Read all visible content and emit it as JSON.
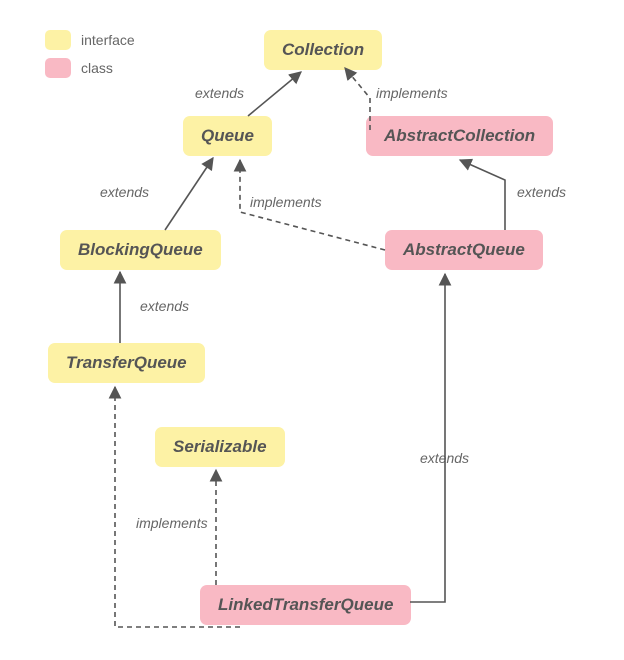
{
  "legend": {
    "interface": "interface",
    "class": "class"
  },
  "colors": {
    "interface": "#fdf2a5",
    "class": "#f9b9c4",
    "text": "#555555",
    "edge": "#555555"
  },
  "nodes": {
    "collection": {
      "label": "Collection",
      "kind": "interface"
    },
    "queue": {
      "label": "Queue",
      "kind": "interface"
    },
    "abstractCollection": {
      "label": "AbstractCollection",
      "kind": "class"
    },
    "blockingQueue": {
      "label": "BlockingQueue",
      "kind": "interface"
    },
    "abstractQueue": {
      "label": "AbstractQueue",
      "kind": "class"
    },
    "transferQueue": {
      "label": "TransferQueue",
      "kind": "interface"
    },
    "serializable": {
      "label": "Serializable",
      "kind": "interface"
    },
    "linkedTransferQueue": {
      "label": "LinkedTransferQueue",
      "kind": "class"
    }
  },
  "edges": [
    {
      "from": "queue",
      "to": "collection",
      "rel": "extends",
      "style": "solid"
    },
    {
      "from": "abstractCollection",
      "to": "collection",
      "rel": "implements",
      "style": "dashed"
    },
    {
      "from": "blockingQueue",
      "to": "queue",
      "rel": "extends",
      "style": "solid"
    },
    {
      "from": "abstractQueue",
      "to": "queue",
      "rel": "implements",
      "style": "dashed"
    },
    {
      "from": "abstractQueue",
      "to": "abstractCollection",
      "rel": "extends",
      "style": "solid"
    },
    {
      "from": "transferQueue",
      "to": "blockingQueue",
      "rel": "extends",
      "style": "solid"
    },
    {
      "from": "linkedTransferQueue",
      "to": "transferQueue",
      "rel": "implements",
      "style": "dashed"
    },
    {
      "from": "linkedTransferQueue",
      "to": "serializable",
      "rel": "implements",
      "style": "dashed"
    },
    {
      "from": "linkedTransferQueue",
      "to": "abstractQueue",
      "rel": "extends",
      "style": "solid"
    }
  ],
  "edgeLabels": {
    "queue_collection": "extends",
    "abstractCollection_collection": "implements",
    "blockingQueue_queue": "extends",
    "abstractQueue_queue": "implements",
    "abstractQueue_abstractCollection": "extends",
    "transferQueue_blockingQueue": "extends",
    "linkedTransferQueue_implements": "implements",
    "linkedTransferQueue_abstractQueue": "extends"
  }
}
